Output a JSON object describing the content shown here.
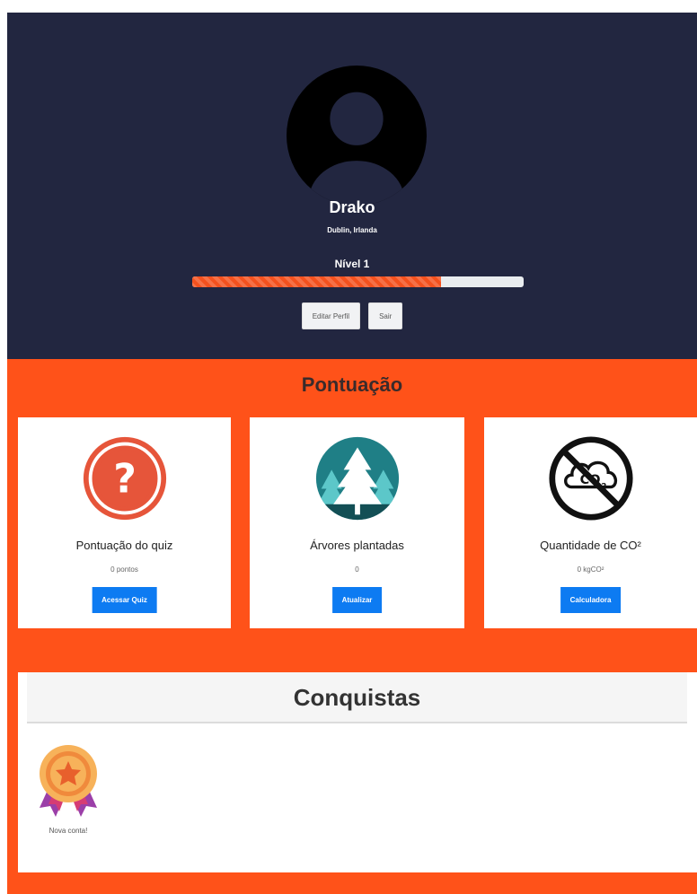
{
  "profile": {
    "name": "Drako",
    "location": "Dublin, Irlanda",
    "level_label": "Nível 1",
    "level_progress_percent": 75,
    "edit_button": "Editar Perfil",
    "logout_button": "Sair"
  },
  "score": {
    "title": "Pontuação",
    "cards": [
      {
        "icon": "question-icon",
        "title": "Pontuação do quiz",
        "value": "0 pontos",
        "button": "Acessar Quiz"
      },
      {
        "icon": "trees-icon",
        "title": "Árvores plantadas",
        "value": "0",
        "button": "Atualizar"
      },
      {
        "icon": "no-co2-icon",
        "title": "Quantidade de CO²",
        "value": "0 kgCO²",
        "button": "Calculadora"
      }
    ]
  },
  "achievements": {
    "title": "Conquistas",
    "badges": [
      {
        "icon": "medal-icon",
        "label": "Nova conta!"
      }
    ]
  },
  "colors": {
    "header_bg": "#222640",
    "accent_orange": "#ff5219",
    "button_blue": "#0d7bf2"
  }
}
